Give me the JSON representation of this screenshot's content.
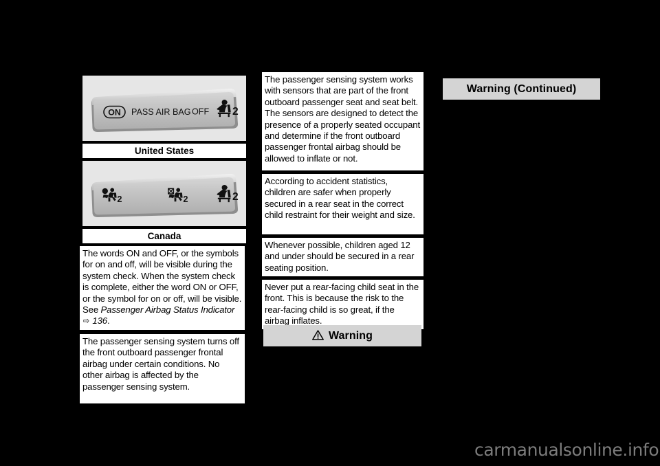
{
  "page": {
    "background_color": "#000000",
    "paper_color": "#ffffff",
    "panel_gray": "#e6e6e6",
    "warning_gray": "#d4d4d4"
  },
  "figures": [
    {
      "id": "us-indicator",
      "caption": "United States",
      "display_type": "passenger-airbag-status-indicator",
      "labels": {
        "on": "ON",
        "title": "PASS AIR BAG",
        "off": "OFF"
      },
      "symbol_digit": "2"
    },
    {
      "id": "canada-indicator",
      "caption": "Canada",
      "display_type": "passenger-airbag-status-indicator",
      "labels": {
        "on": "",
        "title": "",
        "off": ""
      },
      "symbol_digit": "2"
    }
  ],
  "left_column": {
    "cards": [
      {
        "id": "system-check-card",
        "text_before_italic": "The words ON and OFF, or the symbols for on and off, will be visible during the system check. When the system check is complete, either the word ON or OFF, or the symbol for on or off, will be visible. See ",
        "italic_reference": "Passenger Airbag Status Indicator",
        "page_arrow": "⇨",
        "page_number": "136",
        "trailing": "."
      },
      {
        "id": "sensing-system-card",
        "text": "The passenger sensing system turns off the front outboard passenger frontal airbag under certain conditions. No other airbag is affected by the passenger sensing system."
      }
    ]
  },
  "middle_column": {
    "cards": [
      {
        "id": "sensors-card",
        "text": "The passenger sensing system works with sensors that are part of the front outboard passenger seat and seat belt. The sensors are designed to detect the presence of a properly seated occupant and determine if the front outboard passenger frontal airbag should be allowed to inflate or not."
      },
      {
        "id": "accident-statistics-card",
        "text": "According to accident statistics, children are safer when properly secured in a rear seat in the correct child restraint for their weight and size."
      },
      {
        "id": "children-aged-card",
        "text": "Whenever possible, children aged 12 and under should be secured in a rear seating position."
      },
      {
        "id": "rear-facing-card",
        "text": "Never put a rear-facing child seat in the front. This is because the risk to the rear-facing child is so great, if the airbag inflates."
      }
    ],
    "warning_header": {
      "id": "warning-header",
      "label": "Warning",
      "icon": "warning-triangle-icon"
    }
  },
  "right_column": {
    "warning_continued": {
      "id": "warning-continued-header",
      "label": "Warning  (Continued)"
    }
  },
  "watermark": {
    "text": "carmanualsonline.info"
  }
}
